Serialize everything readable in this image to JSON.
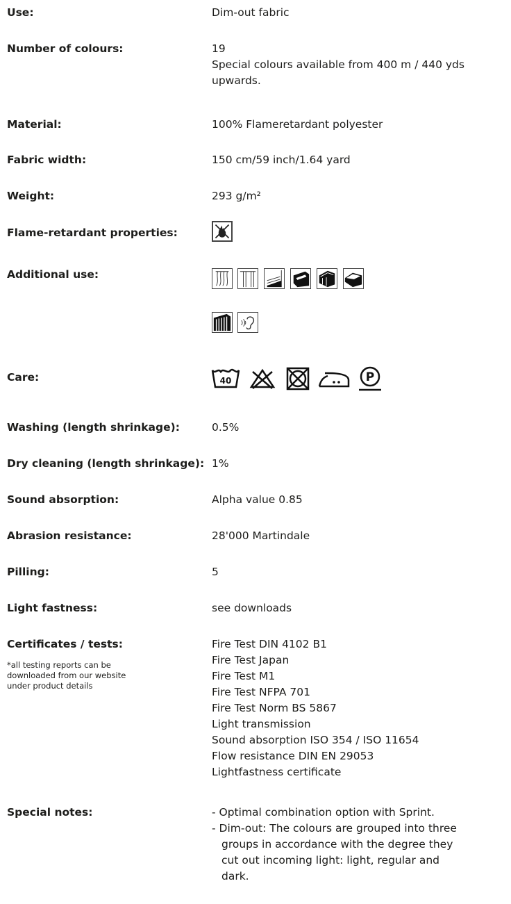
{
  "rows": {
    "use": {
      "label": "Use:",
      "value": "Dim-out fabric"
    },
    "colours": {
      "label": "Number of colours:",
      "value": "19",
      "note_line1": "Special colours available from 400 m / 440 yds",
      "note_line2": "upwards."
    },
    "material": {
      "label": "Material:",
      "value": "100% Flameretardant polyester"
    },
    "width": {
      "label": "Fabric width:",
      "value": "150 cm/59 inch/1.64 yard"
    },
    "weight": {
      "label": "Weight:",
      "value": "293 g/m²"
    },
    "flame": {
      "label": "Flame-retardant properties:",
      "icon": "flame-retardant-icon"
    },
    "additional": {
      "label": "Additional use:",
      "icons": [
        "curtain-icon",
        "panel-curtain-icon",
        "blind-icon",
        "upholstery-icon",
        "bed-skirt-icon",
        "bedspread-icon",
        "vertical-blind-icon",
        "acoustic-ear-icon"
      ]
    },
    "care": {
      "label": "Care:",
      "icons": [
        "wash-40-icon",
        "no-bleach-icon",
        "no-tumble-dry-icon",
        "iron-low-icon",
        "dry-clean-p-icon"
      ],
      "wash_temp": "40",
      "dry_clean_letter": "P"
    },
    "washing": {
      "label": "Washing (length shrinkage):",
      "value": "0.5%"
    },
    "drycleaning": {
      "label": "Dry cleaning (length shrinkage):",
      "value": "1%"
    },
    "sound": {
      "label": "Sound absorption:",
      "value": "Alpha value 0.85"
    },
    "abrasion": {
      "label": "Abrasion resistance:",
      "value": "28'000 Martindale"
    },
    "pilling": {
      "label": "Pilling:",
      "value": "5"
    },
    "light": {
      "label": "Light fastness:",
      "value": "see downloads"
    },
    "certificates": {
      "label": "Certificates / tests:",
      "footnote": [
        "*all testing reports can be",
        "downloaded from our website",
        "under product details"
      ],
      "items": [
        "Fire Test DIN 4102 B1",
        "Fire Test Japan",
        "Fire Test M1",
        "Fire Test NFPA 701",
        "Fire Test Norm BS 5867",
        "Light transmission",
        "Sound absorption ISO 354 / ISO 11654",
        "Flow resistance DIN EN 29053",
        "Lightfastness certificate"
      ]
    },
    "special": {
      "label": "Special notes:",
      "note1": "- Optimal combination option with Sprint.",
      "note2_line1": "- Dim-out: The colours are grouped into three",
      "note2_line2": "groups in accordance with the degree they",
      "note2_line3": "cut out incoming light: light, regular and",
      "note2_line4": "dark."
    }
  }
}
